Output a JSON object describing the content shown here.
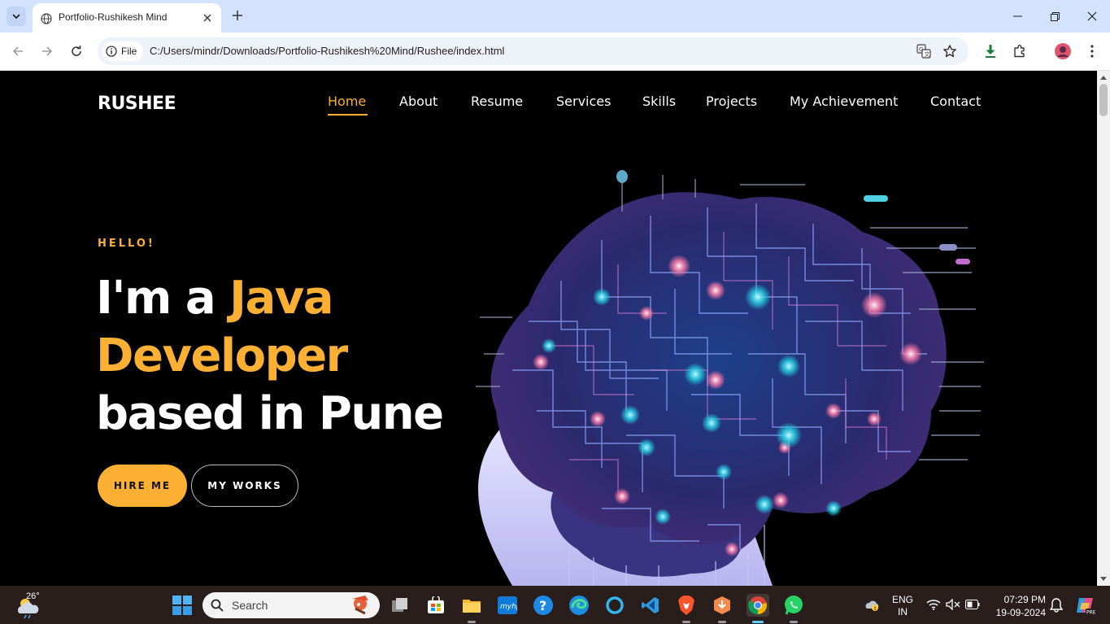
{
  "browser": {
    "tab_title": "Portfolio-Rushikesh Mind",
    "chip_label": "File",
    "url": "C:/Users/mindr/Downloads/Portfolio-Rushikesh%20Mind/Rushee/index.html"
  },
  "site": {
    "logo": "RUSHEE",
    "nav": [
      "Home",
      "About",
      "Resume",
      "Services",
      "Skills",
      "Projects",
      "My Achievement",
      "Contact"
    ],
    "active_nav": "Home",
    "hello": "HELLO!",
    "headline": {
      "prefix": "I'm a ",
      "accent_line1": "Java",
      "accent_line2": "Developer",
      "line3": "based in Pune"
    },
    "buttons": {
      "hire": "HIRE ME",
      "works": "MY WORKS"
    },
    "accent_color": "#fbb034"
  },
  "taskbar": {
    "temperature": "26°",
    "search_placeholder": "Search",
    "lang_line1": "ENG",
    "lang_line2": "IN",
    "time": "07:29 PM",
    "date": "19-09-2024",
    "apps": [
      "task-view",
      "microsoft-store",
      "file-explorer",
      "myhp",
      "help",
      "edge",
      "cortana",
      "vscode",
      "brave",
      "app-installer",
      "chrome",
      "whatsapp"
    ]
  }
}
